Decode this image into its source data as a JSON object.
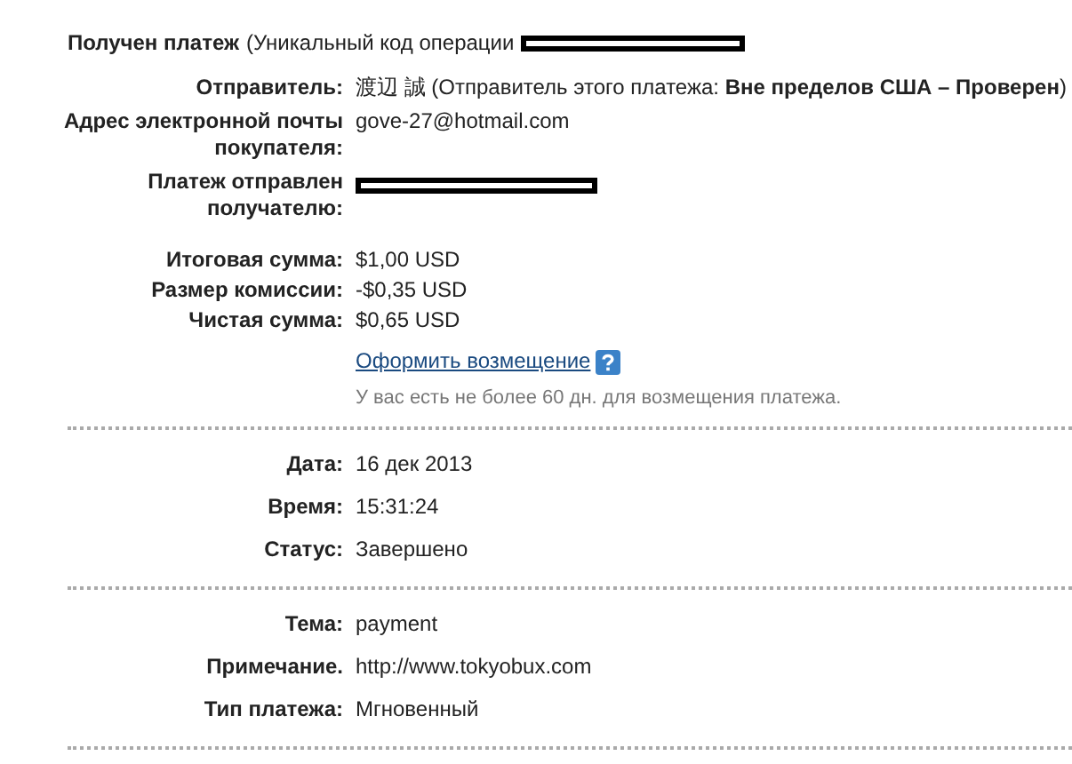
{
  "header": {
    "title": "Получен платеж",
    "text": "(Уникальный код операции",
    "redacted": true
  },
  "sections": [
    {
      "groups": [
        {
          "rows": [
            {
              "label": "Отправитель:",
              "kind": "rich",
              "value": "渡辺 誠 (Отправитель этого платежа: **Вне пределов США – Проверен**)"
            },
            {
              "label": "Адрес электронной почты покупателя:",
              "kind": "text",
              "value": "gove-27@hotmail.com"
            },
            {
              "label": "Платеж отправлен получателю:",
              "kind": "redacted"
            }
          ]
        },
        {
          "rows": [
            {
              "label": "Итоговая сумма:",
              "kind": "text",
              "value": "$1,00 USD"
            },
            {
              "label": "Размер комиссии:",
              "kind": "text",
              "value": "-$0,35 USD"
            },
            {
              "label": "Чистая сумма:",
              "kind": "text",
              "value": "$0,65 USD"
            }
          ]
        }
      ],
      "refund": {
        "link": "Оформить возмещение",
        "note": "У вас есть не более 60 дн. для возмещения платежа."
      }
    },
    {
      "groups": [
        {
          "rows": [
            {
              "label": "Дата:",
              "kind": "text",
              "value": "16 дек 2013"
            },
            {
              "label": "Время:",
              "kind": "text",
              "value": "15:31:24"
            },
            {
              "label": "Статус:",
              "kind": "text",
              "value": "Завершено"
            }
          ]
        }
      ]
    },
    {
      "groups": [
        {
          "rows": [
            {
              "label": "Тема:",
              "kind": "text",
              "value": "payment"
            },
            {
              "label": "Примечание.",
              "kind": "text",
              "value": "http://www.tokyobux.com"
            },
            {
              "label": "Тип платежа:",
              "kind": "text",
              "value": "Мгновенный"
            }
          ]
        }
      ]
    }
  ]
}
